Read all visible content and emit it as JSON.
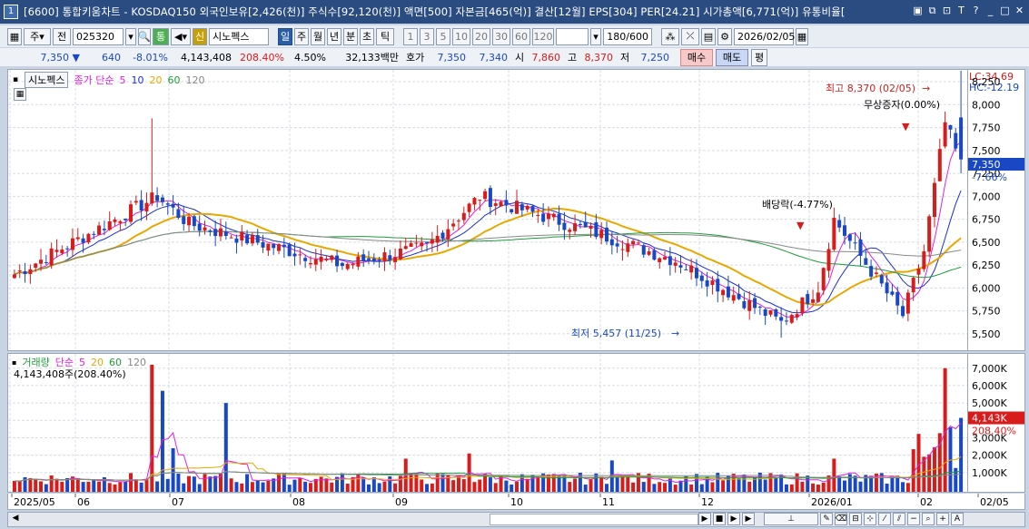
{
  "window": {
    "number": "1",
    "title": "[6600] 통합키움차트 - KOSDAQ150 외국인보유[2,426(천)] 주식수[92,120(천)] 액면[500] 자본금[465(억)] 결산[12월] EPS[304] PER[24.21] 시가총액[6,771(억)] 유통비율[",
    "icons": [
      "restore-icon",
      "copy-icon",
      "pin-icon",
      "font-icon",
      "help-icon",
      "minimize-icon",
      "maximize-icon",
      "close-icon"
    ]
  },
  "toolbar": {
    "period_type": "주",
    "prev_label": "전",
    "code": "025320",
    "tong_label": "통",
    "sin_label": "신",
    "stock_name": "시노펙스",
    "period_tabs": [
      "일",
      "주",
      "월",
      "년",
      "분",
      "초",
      "틱"
    ],
    "active_tab": "일",
    "numbers": [
      "1",
      "3",
      "5",
      "10",
      "20",
      "30",
      "60",
      "120"
    ],
    "count": "180/600",
    "date": "2026/02/05"
  },
  "quote": {
    "price": "7,350",
    "change": "640",
    "change_pct": "-8.01%",
    "volume": "4,143,408",
    "vol_ratio": "208.40%",
    "turnover": "4.50%",
    "amount": "32,133백만",
    "hoga_label": "호가",
    "ask": "7,350",
    "bid": "7,340",
    "open_label": "시",
    "open": "7,860",
    "high_label": "고",
    "high": "8,370",
    "low_label": "저",
    "low": "7,250",
    "buy_label": "매수",
    "sell_label": "매도",
    "avg_label": "평"
  },
  "price_legend": {
    "name": "시노펙스",
    "desc": "종가 단순",
    "ma": [
      {
        "label": "5",
        "color": "#e020e0"
      },
      {
        "label": "10",
        "color": "#1a2fd0"
      },
      {
        "label": "20",
        "color": "#e8a800"
      },
      {
        "label": "60",
        "color": "#1e9c3a"
      },
      {
        "label": "120",
        "color": "#888888"
      }
    ]
  },
  "vol_legend": {
    "name": "거래량",
    "desc": "단순",
    "ma": [
      {
        "label": "5",
        "color": "#e020e0"
      },
      {
        "label": "20",
        "color": "#e8a800"
      },
      {
        "label": "60",
        "color": "#1e9c3a"
      },
      {
        "label": "120",
        "color": "#888888"
      }
    ],
    "value_text": "4,143,408주(208.40%)"
  },
  "annotations": {
    "high": "최고 8,370 (02/05)",
    "low": "최저 5,457 (11/25)",
    "dividend": "배당락(-4.77%)",
    "bonus": "무상증자(0.00%)"
  },
  "price_scale": {
    "lc": "LC:34.69",
    "hc": "HC:-12.19",
    "ticks": [
      "8,250",
      "8,000",
      "7,750",
      "7,500",
      "7,250",
      "7,000",
      "6,750",
      "6,500",
      "6,250",
      "6,000",
      "5,750",
      "5,500"
    ],
    "current": "7,350",
    "current_pct": "-7.66%"
  },
  "vol_scale": {
    "ticks": [
      "7,000K",
      "6,000K",
      "5,000K",
      "4,000K",
      "3,000K",
      "2,000K",
      "1,000K"
    ],
    "current": "4,143K",
    "current_pct": "208.40%"
  },
  "date_axis": {
    "labels": [
      "2025/05",
      "06",
      "07",
      "08",
      "09",
      "10",
      "11",
      "12",
      "2026/01",
      "02",
      "02/05"
    ]
  },
  "colors": {
    "up": "#d81b1b",
    "down": "#1a48c4",
    "grid": "#d7dce4",
    "title_bg": "#2b4c80"
  },
  "chart_data": {
    "type": "candlestick",
    "title": "시노펙스",
    "x_range": [
      "2025/05",
      "2026/02/05"
    ],
    "price_range": [
      5400,
      8300
    ],
    "key_points": [
      {
        "date": "2025/05",
        "close": 6150
      },
      {
        "date": "07",
        "high": 7850,
        "close": 6900
      },
      {
        "date": "08",
        "close": 6250
      },
      {
        "date": "09",
        "high": 7200,
        "close": 6800
      },
      {
        "date": "10",
        "close": 6600
      },
      {
        "date": "11/25",
        "low": 5457
      },
      {
        "date": "12",
        "close": 6700
      },
      {
        "date": "2026/01",
        "close": 5700
      },
      {
        "date": "02/05",
        "high": 8370,
        "close": 7350
      }
    ],
    "volume_range_K": [
      0,
      7300
    ],
    "volume_last_K": 4143
  }
}
